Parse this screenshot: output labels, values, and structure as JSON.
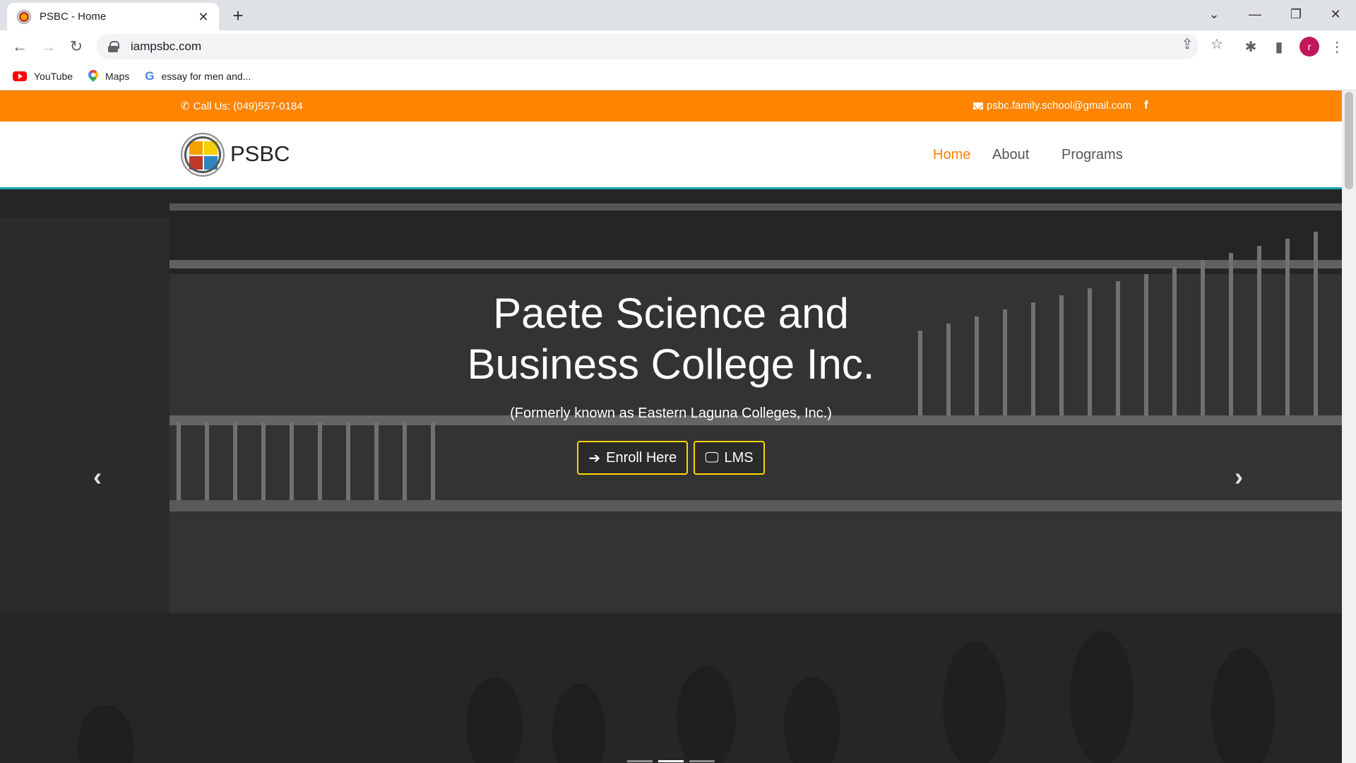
{
  "browser": {
    "tab_title": "PSBC - Home",
    "url": "iampsbc.com",
    "avatar_initial": "r",
    "bookmarks": [
      {
        "label": "YouTube",
        "icon": "youtube-icon"
      },
      {
        "label": "Maps",
        "icon": "maps-icon"
      },
      {
        "label": "essay for men and...",
        "icon": "google-icon"
      }
    ]
  },
  "topbar": {
    "call": "Call Us: (049)557-0184",
    "email": "psbc.family.school@gmail.com",
    "facebook_glyph": "f"
  },
  "navbar": {
    "brand": "PSBC",
    "links": [
      {
        "label": "Home",
        "active": true
      },
      {
        "label": "About",
        "active": false
      },
      {
        "label": "Programs",
        "active": false
      }
    ],
    "accent": "#ff8400"
  },
  "hero": {
    "title_line1": "Paete Science and",
    "title_line2": "Business College Inc.",
    "subtitle": "(Formerly known as Eastern Laguna Colleges, Inc.)",
    "enroll_label": "Enroll Here",
    "lms_label": "LMS",
    "active_slide": 2,
    "slide_count": 3
  }
}
